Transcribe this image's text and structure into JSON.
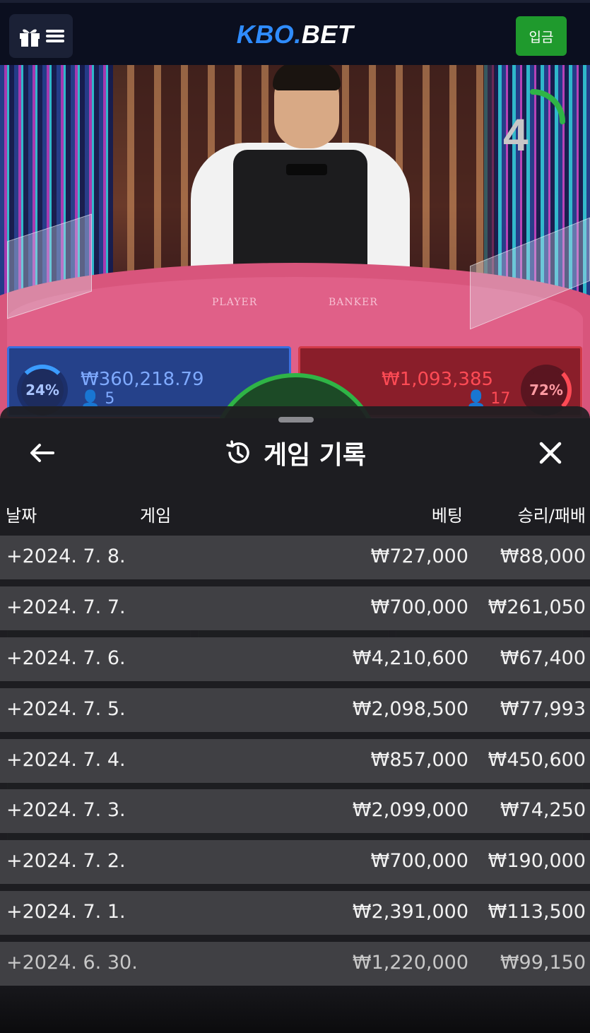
{
  "header": {
    "logo_part1": "KBO.",
    "logo_part2": "BET",
    "deposit_label": "입금",
    "menu_icon": "gift-menu-icon"
  },
  "stream": {
    "countdown": "4",
    "table_label_player": "PLAYER",
    "table_label_banker": "BANKER",
    "player": {
      "percent": "24%",
      "amount": "₩360,218.79",
      "bettors": "5"
    },
    "banker": {
      "percent": "72%",
      "amount": "₩1,093,385",
      "bettors": "17"
    }
  },
  "sheet": {
    "title": "게임 기록",
    "title_icon": "history-icon",
    "back_icon": "arrow-left-icon",
    "close_icon": "close-icon",
    "columns": {
      "date": "날짜",
      "game": "게임",
      "bet": "베팅",
      "result": "승리/패배"
    },
    "rows": [
      {
        "date": "+2024. 7. 8.",
        "bet": "₩727,000",
        "result": "₩88,000"
      },
      {
        "date": "+2024. 7. 7.",
        "bet": "₩700,000",
        "result": "₩261,050"
      },
      {
        "date": "+2024. 7. 6.",
        "bet": "₩4,210,600",
        "result": "₩67,400"
      },
      {
        "date": "+2024. 7. 5.",
        "bet": "₩2,098,500",
        "result": "₩77,993"
      },
      {
        "date": "+2024. 7. 4.",
        "bet": "₩857,000",
        "result": "₩450,600"
      },
      {
        "date": "+2024. 7. 3.",
        "bet": "₩2,099,000",
        "result": "₩74,250"
      },
      {
        "date": "+2024. 7. 2.",
        "bet": "₩700,000",
        "result": "₩190,000"
      },
      {
        "date": "+2024. 7. 1.",
        "bet": "₩2,391,000",
        "result": "₩113,500"
      },
      {
        "date": "+2024. 6. 30.",
        "bet": "₩1,220,000",
        "result": "₩99,150"
      }
    ]
  },
  "colors": {
    "accent_blue": "#2f8cff",
    "deposit_green": "#1f9a2d",
    "player_blue": "#3a6fe0",
    "banker_red": "#d23a48",
    "tie_green": "#2fb446"
  }
}
